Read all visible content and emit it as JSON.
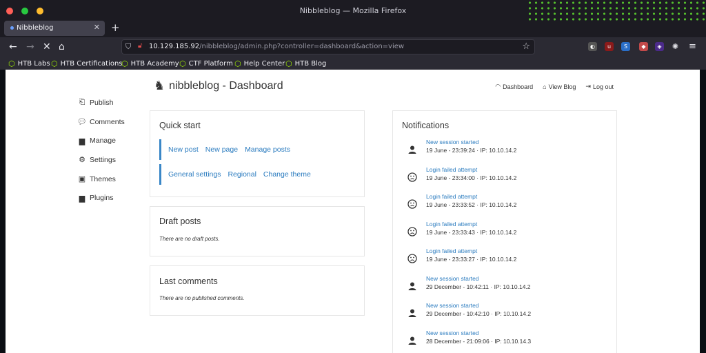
{
  "window": {
    "title": "Nibbleblog — Mozilla Firefox"
  },
  "tab": {
    "label": "Nibbleblog"
  },
  "url": {
    "host": "10.129.185.92",
    "path": "/nibbleblog/admin.php?controller=dashboard&action=view"
  },
  "bookmarks": [
    {
      "label": "HTB Labs"
    },
    {
      "label": "HTB Certifications"
    },
    {
      "label": "HTB Academy"
    },
    {
      "label": "CTF Platform"
    },
    {
      "label": "Help Center"
    },
    {
      "label": "HTB Blog"
    }
  ],
  "sidebar": {
    "items": [
      {
        "label": "Publish",
        "icon": "publish-icon"
      },
      {
        "label": "Comments",
        "icon": "comment-icon"
      },
      {
        "label": "Manage",
        "icon": "folder-icon"
      },
      {
        "label": "Settings",
        "icon": "gear-icon"
      },
      {
        "label": "Themes",
        "icon": "image-icon"
      },
      {
        "label": "Plugins",
        "icon": "folder-icon"
      }
    ]
  },
  "header": {
    "title": "nibbleblog - Dashboard",
    "links": [
      {
        "label": "Dashboard",
        "icon": "dashboard-icon"
      },
      {
        "label": "View Blog",
        "icon": "home-icon"
      },
      {
        "label": "Log out",
        "icon": "logout-icon"
      }
    ]
  },
  "quick_start": {
    "title": "Quick start",
    "row1": [
      "New post",
      "New page",
      "Manage posts"
    ],
    "row2": [
      "General settings",
      "Regional",
      "Change theme"
    ]
  },
  "draft_posts": {
    "title": "Draft posts",
    "empty": "There are no draft posts."
  },
  "last_comments": {
    "title": "Last comments",
    "empty": "There are no published comments."
  },
  "notifications": {
    "title": "Notifications",
    "items": [
      {
        "title": "New session started",
        "meta": "19 June - 23:39:24 · IP: 10.10.14.2",
        "icon": "user-icon"
      },
      {
        "title": "Login failed attempt",
        "meta": "19 June - 23:34:00 · IP: 10.10.14.2",
        "icon": "sad-face-icon"
      },
      {
        "title": "Login failed attempt",
        "meta": "19 June - 23:33:52 · IP: 10.10.14.2",
        "icon": "sad-face-icon"
      },
      {
        "title": "Login failed attempt",
        "meta": "19 June - 23:33:43 · IP: 10.10.14.2",
        "icon": "sad-face-icon"
      },
      {
        "title": "Login failed attempt",
        "meta": "19 June - 23:33:27 · IP: 10.10.14.2",
        "icon": "sad-face-icon"
      },
      {
        "title": "New session started",
        "meta": "29 December - 10:42:11 · IP: 10.10.14.2",
        "icon": "user-icon"
      },
      {
        "title": "New session started",
        "meta": "29 December - 10:42:10 · IP: 10.10.14.2",
        "icon": "user-icon"
      },
      {
        "title": "New session started",
        "meta": "28 December - 21:09:06 · IP: 10.10.14.3",
        "icon": "user-icon"
      }
    ]
  },
  "colors": {
    "link": "#2a7bbf",
    "accent_bar": "#3a87c7",
    "htb_green": "#9fef00"
  }
}
